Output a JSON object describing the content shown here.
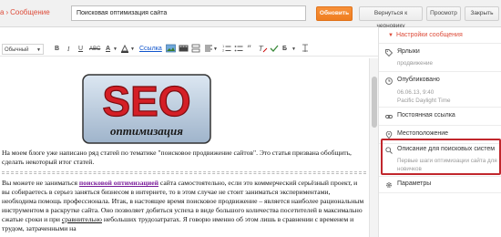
{
  "header": {
    "breadcrumb_app": "а",
    "breadcrumb_page": "Сообщение",
    "post_title": "Поисковая оптимизация сайта",
    "buttons": {
      "publish": "Обновить",
      "revert": "Вернуться к черновику",
      "preview": "Просмотр",
      "close": "Закрыть"
    }
  },
  "toolbar": {
    "font_size": "Обычный",
    "bold": "B",
    "italic": "I",
    "underline": "U",
    "strike": "ABC",
    "text_color": "A",
    "link": "Ссылка",
    "font_aa": "Б"
  },
  "editor": {
    "logo_word": "SEO",
    "logo_sub": "оптимизация",
    "para1": "На моем блоге уже написано ряд статей по тематике \"поисковое продвижение сайтов\". Это статья призвана обобщить, сделать некоторый итог статей.",
    "para2_part1": "Вы можете не заниматься ",
    "para2_link": "поисковой оптимизацией",
    "para2_part2": " сайта самостоятельно, если это коммерческий серьёзный проект, и вы собираетесь в серьез заняться бизнесом в интернете, то в этом случае не стоит заниматься экспериментами, необходима помощь профессионала. Итак, в настоящее время поисковое продвижение – является наиболее рациональным инструментом в раскрутке сайта. Оно позволяет добиться успеха в виде большого количества посетителей в максимально сжатые сроки и при ",
    "para2_under": "сравнительно",
    "para2_part3": " небольших трудозатратах. Я говорю именно об этом лишь в сравнении с временем и трудом, затраченными на"
  },
  "sidebar": {
    "header": "Настройки сообщения",
    "labels": {
      "title": "Ярлыки",
      "sub": "продвижение"
    },
    "published": {
      "title": "Опубликовано",
      "date": "06.06.13, 9:40",
      "tz": "Pacific Daylight Time"
    },
    "permalink": {
      "title": "Постоянная ссылка"
    },
    "location": {
      "title": "Местоположение"
    },
    "search_desc": {
      "title": "Описание для поисковых систем",
      "sub": "Первые шаги оптимизации сайта для новичков"
    },
    "params": {
      "title": "Параметры"
    }
  },
  "colors": {
    "accent": "#dd4b39",
    "publish": "#f08226",
    "highlight_box": "#c1272d",
    "link": "#7a1c9a"
  }
}
